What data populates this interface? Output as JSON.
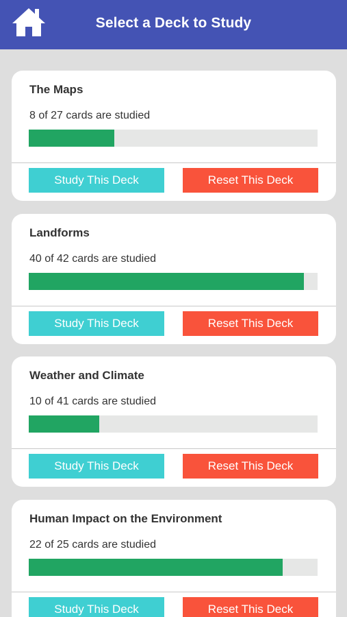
{
  "header": {
    "title": "Select a Deck to Study",
    "home_icon": "home-icon"
  },
  "colors": {
    "header_bg": "#4453b4",
    "page_bg": "#dedede",
    "progress_fill": "#21a562",
    "progress_track": "#e6e7e6",
    "study_button": "#3fcfd2",
    "reset_button": "#f9533b"
  },
  "decks": [
    {
      "title": "The Maps",
      "progress_text": "8 of 27 cards are studied",
      "studied": 8,
      "total": 27,
      "study_label": "Study This Deck",
      "reset_label": "Reset This Deck"
    },
    {
      "title": "Landforms",
      "progress_text": "40 of 42 cards are studied",
      "studied": 40,
      "total": 42,
      "study_label": "Study This Deck",
      "reset_label": "Reset This Deck"
    },
    {
      "title": "Weather and Climate",
      "progress_text": "10 of 41 cards are studied",
      "studied": 10,
      "total": 41,
      "study_label": "Study This Deck",
      "reset_label": "Reset This Deck"
    },
    {
      "title": "Human Impact on the Environment",
      "progress_text": "22 of 25 cards are studied",
      "studied": 22,
      "total": 25,
      "study_label": "Study This Deck",
      "reset_label": "Reset This Deck"
    }
  ]
}
